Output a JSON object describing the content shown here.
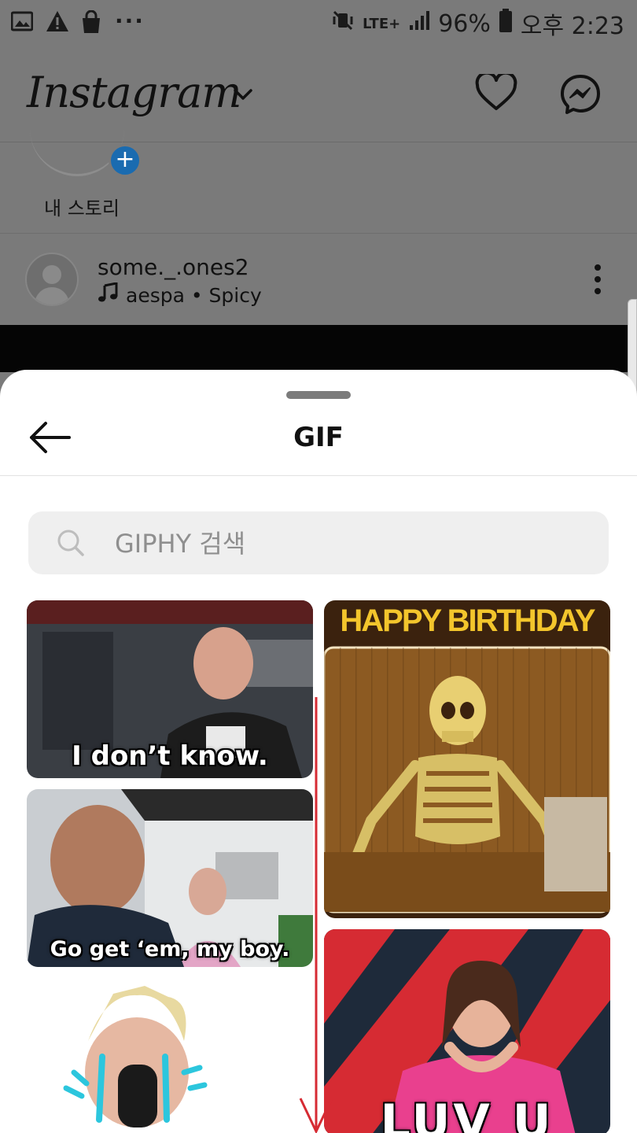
{
  "status_bar": {
    "battery": "96%",
    "network": "LTE+",
    "time": "오후 2:23",
    "more_indicator": "···"
  },
  "app": {
    "name": "Instagram",
    "icons": [
      "heart-icon",
      "messenger-icon"
    ]
  },
  "stories": {
    "my_story_label": "내 스토리"
  },
  "post": {
    "username": "some._.ones2",
    "music": "aespa • Spicy"
  },
  "gif_sheet": {
    "title": "GIF",
    "search_placeholder": "GIPHY 검색",
    "gifs": [
      {
        "caption": "I don’t know."
      },
      {
        "caption": "HAPPY BIRTHDAY"
      },
      {
        "caption": "Go get ‘em, my boy."
      },
      {
        "caption": "LUV U"
      }
    ]
  },
  "colors": {
    "overlay_gray": "#7a7a7a",
    "story_plus_blue": "#1a6bb0",
    "search_bg": "#efefef",
    "annotation_red": "#d62b33",
    "birthday_yellow": "#f3c52c"
  }
}
